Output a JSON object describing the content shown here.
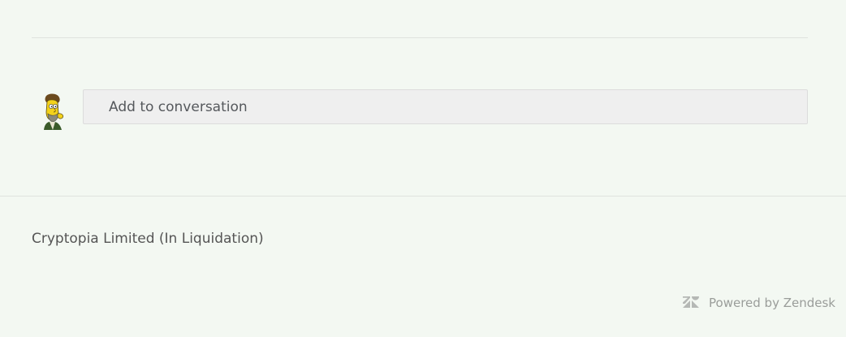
{
  "comment": {
    "placeholder": "Add to conversation",
    "avatar_icon": "user-avatar-cartoon"
  },
  "footer": {
    "company_name": "Cryptopia Limited (In Liquidation)",
    "powered_by": "Powered by Zendesk",
    "logo_icon": "zendesk-logo-icon"
  },
  "colors": {
    "background": "#f3f8f2",
    "input_background": "#efefef",
    "text_muted": "#9a9d9a"
  }
}
